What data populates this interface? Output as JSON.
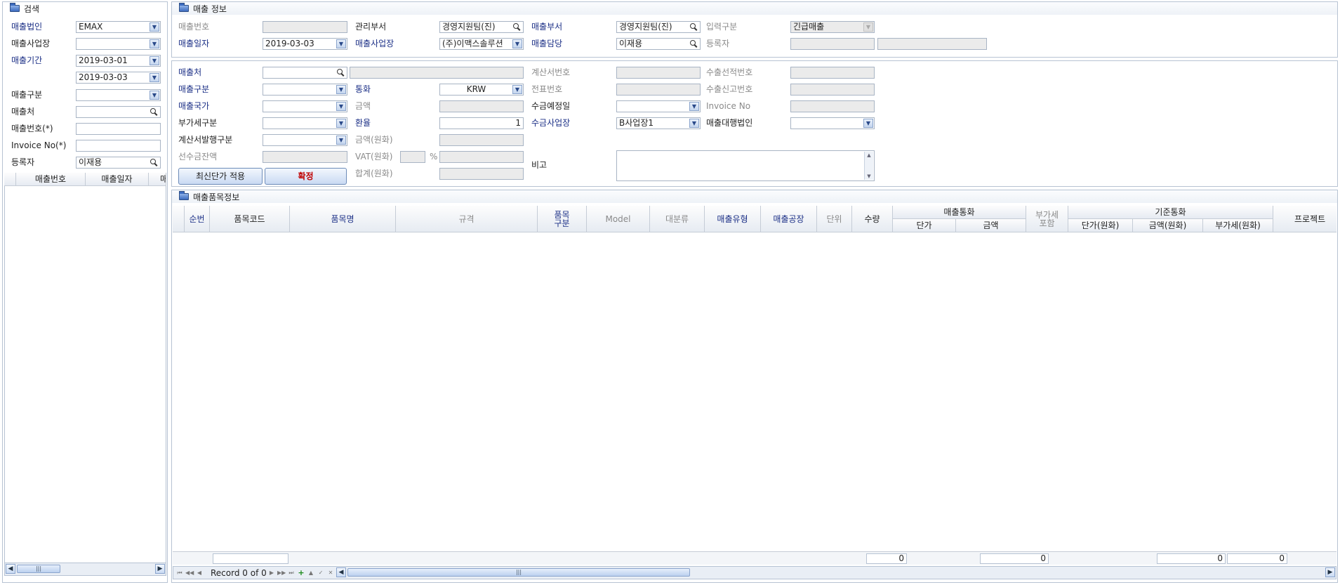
{
  "search_panel": {
    "title": "검색",
    "fields": {
      "corp_label": "매출법인",
      "corp_value": "EMAX",
      "site_label": "매출사업장",
      "site_value": "",
      "period_label": "매출기간",
      "period_from": "2019-03-01",
      "period_to": "2019-03-03",
      "type_label": "매출구분",
      "type_value": "",
      "customer_label": "매출처",
      "customer_value": "",
      "sales_no_label": "매출번호(*)",
      "sales_no_value": "",
      "invoice_label": "Invoice No(*)",
      "invoice_value": "",
      "registrant_label": "등록자",
      "registrant_value": "이재용"
    },
    "list_columns": [
      "매출번호",
      "매출일자",
      "매"
    ]
  },
  "sales_info": {
    "title": "매출 정보",
    "sales_no_label": "매출번호",
    "sales_no_value": "",
    "mgmt_dept_label": "관리부서",
    "mgmt_dept_value": "경영지원팀(진)",
    "sales_dept_label": "매출부서",
    "sales_dept_value": "경영지원팀(진)",
    "input_type_label": "입력구분",
    "input_type_value": "긴급매출",
    "sales_date_label": "매출일자",
    "sales_date_value": "2019-03-03",
    "sales_site_label": "매출사업장",
    "sales_site_value": "(주)이맥스솔루션",
    "sales_manager_label": "매출담당",
    "sales_manager_value": "이재용",
    "registrant_label": "등록자",
    "registrant_value": "",
    "registrant_value2": ""
  },
  "detail": {
    "customer_label": "매출처",
    "customer_value": "",
    "customer_name": "",
    "invoice_doc_label": "계산서번호",
    "invoice_doc_value": "",
    "export_ship_label": "수출선적번호",
    "export_ship_value": "",
    "sales_type_label": "매출구분",
    "sales_type_value": "",
    "currency_label": "통화",
    "currency_value": "KRW",
    "voucher_label": "전표번호",
    "voucher_value": "",
    "export_decl_label": "수출신고번호",
    "export_decl_value": "",
    "country_label": "매출국가",
    "country_value": "",
    "amount_label": "금액",
    "amount_value": "",
    "collect_date_label": "수금예정일",
    "collect_date_value": "",
    "invoice_no_label": "Invoice No",
    "invoice_no_value": "",
    "vat_type_label": "부가세구분",
    "vat_type_value": "",
    "rate_label": "환율",
    "rate_value": "1",
    "collect_site_label": "수금사업장",
    "collect_site_value": "B사업장1",
    "agency_label": "매출대행법인",
    "agency_value": "",
    "issue_type_label": "계산서발행구분",
    "issue_type_value": "",
    "amount_krw_label": "금액(원화)",
    "amount_krw_value": "",
    "advance_label": "선수금잔액",
    "advance_value": "",
    "vat_krw_label": "VAT(원화)",
    "vat_krw_value": "",
    "vat_pct": "%",
    "vat_krw_value2": "",
    "remark_label": "비고",
    "remark_value": "",
    "total_krw_label": "합계(원화)",
    "total_krw_value": "",
    "btn_latest_price": "최신단가 적용",
    "btn_confirm": "확정"
  },
  "item_panel": {
    "title": "매출품목정보",
    "columns": {
      "seq": "순번",
      "item_code": "품목코드",
      "item_name": "품목명",
      "spec": "규격",
      "item_type": "품목\n구분",
      "model": "Model",
      "category": "대분류",
      "sales_type": "매출유형",
      "factory": "매출공장",
      "unit": "단위",
      "qty": "수량",
      "sales_currency": "매출통화",
      "unit_price": "단가",
      "amount": "금액",
      "vat_incl": "부가세\n포함",
      "base_currency": "기준통화",
      "unit_price_krw": "단가(원화)",
      "amount_krw": "금액(원화)",
      "vat_krw": "부가세(원화)",
      "project": "프로젝트"
    },
    "summary": {
      "qty": "0",
      "amount": "0",
      "amount_krw": "0",
      "vat_krw": "0"
    },
    "record_text": "Record 0 of 0"
  }
}
